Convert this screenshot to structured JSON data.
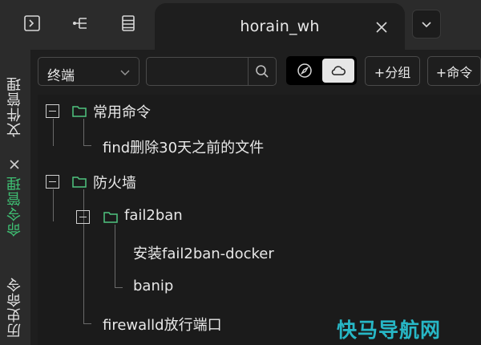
{
  "tab": {
    "title": "horain_wh"
  },
  "sidebar": {
    "tabs": [
      {
        "label": "文件管理"
      },
      {
        "label": "命令管理"
      },
      {
        "label": "历史命令"
      }
    ]
  },
  "toolbar": {
    "type_select": "终端",
    "search_value": "",
    "add_group": "+分组",
    "add_command": "+命令"
  },
  "tree": {
    "group1": {
      "label": "常用命令",
      "items": [
        "find删除30天之前的文件"
      ]
    },
    "group2": {
      "label": "防火墙",
      "subgroup": {
        "label": "fail2ban",
        "items": [
          "安装fail2ban-docker",
          "banip"
        ]
      },
      "items": [
        "firewalld放行端口"
      ]
    }
  },
  "watermark": "快马导航网",
  "colors": {
    "accent_green": "#3fbf73",
    "folder_green": "#4fc47f",
    "watermark": "#27b7c6"
  }
}
